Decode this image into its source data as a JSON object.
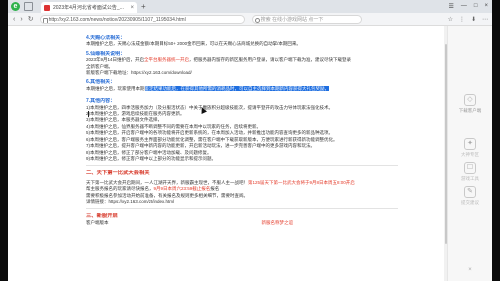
{
  "browser": {
    "logo_glyph": "e",
    "tab_title": "2023年4月河北省考面试公告_...",
    "tab_close": "×",
    "new_tab": "+",
    "url": "http://xy2.163.com/news/notice/20230905/1107_1195034.html",
    "search_placeholder": "搜索 在线小游戏网站 点一下",
    "window_controls": [
      "☰",
      "—",
      "□",
      "×"
    ],
    "nav_glyphs": [
      "‹",
      "›",
      "↻"
    ],
    "toolbar_glyphs": [
      "☆",
      "⋮",
      "⬇",
      "⋯"
    ]
  },
  "article": {
    "section4_title": "4.天赐心法相关：",
    "section4_lines": [
      "本期推护之后，天赐心法成金额/本期目标50+ 2000金币回来，可以在天赐心法商城兑换的自动掌/本期回来。"
    ],
    "section5_title": "5.仙缘相关说明：",
    "section5_lines": [
      "2023年9月14日维护后，开启",
      "全平台服务器统一开启"
    ],
    "section5_line1_suffix": "，把服务器内留存的新区服务用户登录，请以客户端下载为准，建议尽快下载登录",
    "section5_line2": "全新客户端。",
    "section5_line3": "新版客户端下载地址：https://xy2.163.com/download/",
    "section6_title": "6.其他相关：",
    "section6_line1_prefix": "本期维护之后，玩家使用本期",
    "section6_line1_selected": "鉴定结果功能后，在获得其他所需的消耗品时，可以自主选择到本期新内容获得大礼包奖励，",
    "section6_line1_suffix": "",
    "section7_title": "7.其他内容：",
    "section7_lines": [
      "1)本周维护之后，四季活服务加力（及分服活状态）中关于魔族积分超级技能次，提请平登开的攻击力导体玩家法强化技术。",
      "2)本周维护之后，游戏后续技能在服务内容更新。",
      "3)本周维护之后，本服务器文件选择，",
      "4)本周维护之后，仙界服务器不断调整不同的需要在本周中以玩家的任务，后续将更新。",
      "5)本周维护之后，开启客户端中的各项功能将开启更新系统的，在本周加入活动，并新推出功能内容查询更多的新品种选项。",
      "6)本周维护之后，客户端服务主界面部分功能优化调整，需在客户端中下载获取新版本，方便玩家进行新获得新功能调整优化。",
      "7)本周维护之后，提升客户端中新内容的功能更新，开启新活动玩法，进一步完善客户端中的更多游戏内容和玩法。",
      "8)本周维护之后，修正了部分客户端中活动加载、及问题修复。",
      "9)本周维护之后，修正客户端中以上部分的功能显示和提示问题。"
    ],
    "promo_title": "二、天下第一比武大会相关",
    "promo_line1_prefix": "天下第一比武大会开启期间，一人江湖开天界，新服霸主现世，不服人主一战吧！",
    "promo_line1_red": "第125届天下第一比武大会将于9月8日本周五8:00开启",
    "promo_line2_prefix": "",
    "promo_line2": "帮主服务报名的玩家请尽快报名，",
    "promo_line2_red": "9月9日本周六23:59截止报名",
    "promo_line2_suffix": "报名",
    "promo_line3": "需要积极报名参加活动开始前准备，有关报名及规则更多相关细节，需要时查阅。",
    "promo_line4": "详情链接：https://xy2.163.com/zt/index.html",
    "section3_title": "三、新服开启",
    "section3_line_prefix": "客户端版本",
    "section3_line_red": "新服名称",
    "section3_line_suffix": "梦之谊"
  },
  "side_panel": {
    "items": [
      {
        "glyph": "◇",
        "label": "下载客户端"
      },
      {
        "glyph": "✦",
        "label": "大神专区"
      },
      {
        "glyph": "☐",
        "label": "游戏工具"
      },
      {
        "glyph": "✎",
        "label": "提交建议"
      }
    ],
    "close_glyph": "×"
  }
}
